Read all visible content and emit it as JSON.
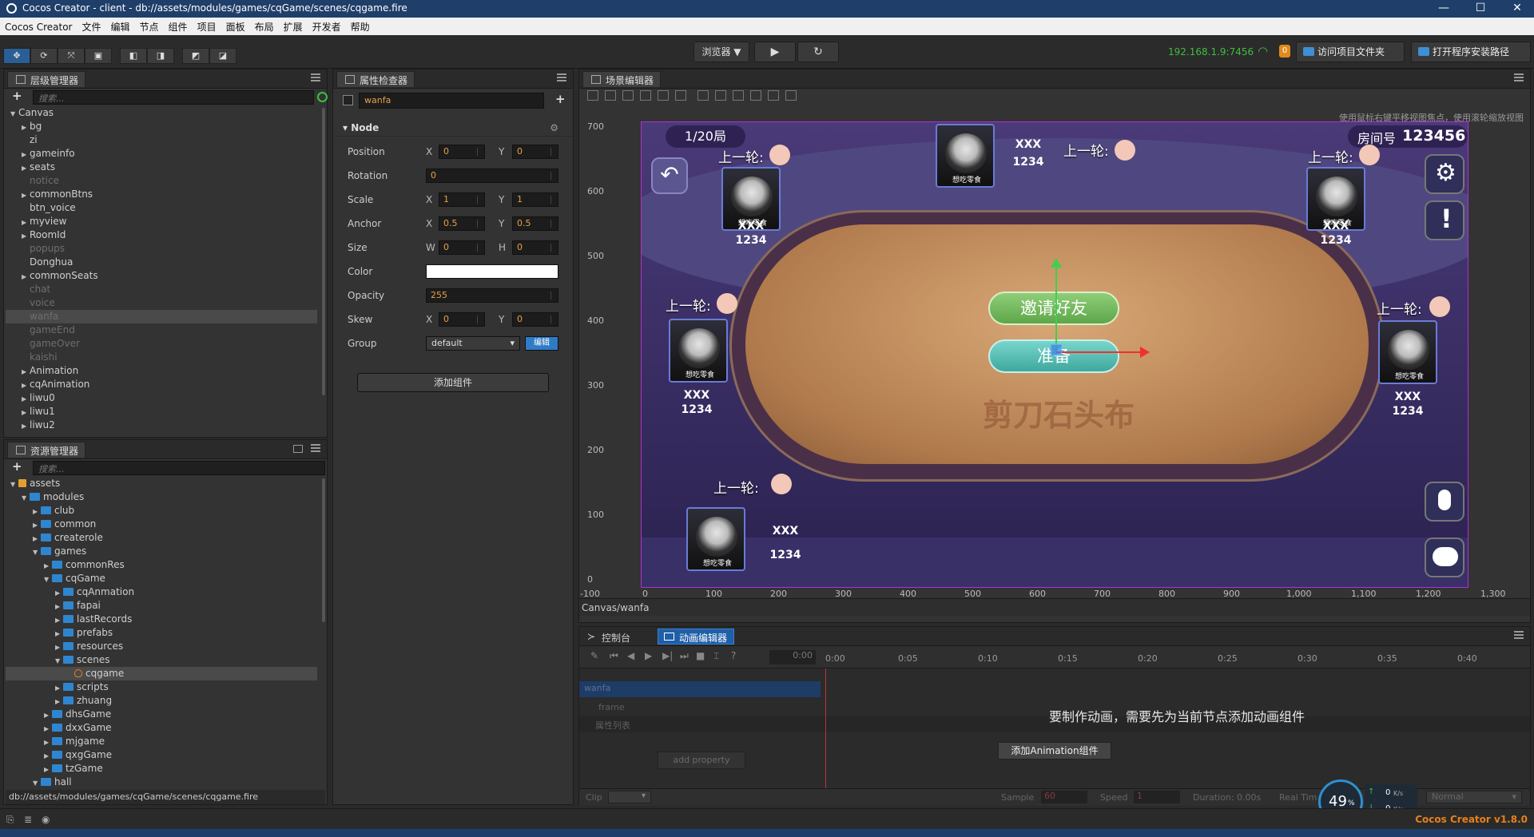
{
  "window": {
    "title": "Cocos Creator - client - db://assets/modules/games/cqGame/scenes/cqgame.fire"
  },
  "menu": [
    "Cocos Creator",
    "文件",
    "编辑",
    "节点",
    "组件",
    "项目",
    "面板",
    "布局",
    "扩展",
    "开发者",
    "帮助"
  ],
  "toolbar": {
    "preview_select": "浏览器 ▼",
    "play": "▶",
    "refresh": "↻",
    "ip": "192.168.1.9:7456",
    "badge": "0",
    "open_project_btn": "访问项目文件夹",
    "open_install_btn": "打开程序安装路径"
  },
  "hierarchy": {
    "tab": "层级管理器",
    "search_placeholder": "搜索...",
    "nodes": [
      {
        "label": "Canvas",
        "depth": 0,
        "arrow": "▼",
        "dim": false
      },
      {
        "label": "bg",
        "depth": 1,
        "arrow": "▶",
        "dim": false
      },
      {
        "label": "zi",
        "depth": 1,
        "arrow": "",
        "dim": false
      },
      {
        "label": "gameinfo",
        "depth": 1,
        "arrow": "▶",
        "dim": false
      },
      {
        "label": "seats",
        "depth": 1,
        "arrow": "▶",
        "dim": false
      },
      {
        "label": "notice",
        "depth": 1,
        "arrow": "",
        "dim": true
      },
      {
        "label": "commonBtns",
        "depth": 1,
        "arrow": "▶",
        "dim": false
      },
      {
        "label": "btn_voice",
        "depth": 1,
        "arrow": "",
        "dim": false
      },
      {
        "label": "myview",
        "depth": 1,
        "arrow": "▶",
        "dim": false
      },
      {
        "label": "RoomId",
        "depth": 1,
        "arrow": "▶",
        "dim": false
      },
      {
        "label": "popups",
        "depth": 1,
        "arrow": "",
        "dim": true
      },
      {
        "label": "Donghua",
        "depth": 1,
        "arrow": "",
        "dim": false
      },
      {
        "label": "commonSeats",
        "depth": 1,
        "arrow": "▶",
        "dim": false
      },
      {
        "label": "chat",
        "depth": 1,
        "arrow": "",
        "dim": true
      },
      {
        "label": "voice",
        "depth": 1,
        "arrow": "",
        "dim": true
      },
      {
        "label": "wanfa",
        "depth": 1,
        "arrow": "",
        "dim": true,
        "selected": true
      },
      {
        "label": "gameEnd",
        "depth": 1,
        "arrow": "",
        "dim": true
      },
      {
        "label": "gameOver",
        "depth": 1,
        "arrow": "",
        "dim": true
      },
      {
        "label": "kaishi",
        "depth": 1,
        "arrow": "",
        "dim": true
      },
      {
        "label": "Animation",
        "depth": 1,
        "arrow": "▶",
        "dim": false
      },
      {
        "label": "cqAnimation",
        "depth": 1,
        "arrow": "▶",
        "dim": false
      },
      {
        "label": "liwu0",
        "depth": 1,
        "arrow": "▶",
        "dim": false
      },
      {
        "label": "liwu1",
        "depth": 1,
        "arrow": "▶",
        "dim": false
      },
      {
        "label": "liwu2",
        "depth": 1,
        "arrow": "▶",
        "dim": false
      }
    ]
  },
  "assets": {
    "tab": "资源管理器",
    "search_placeholder": "搜索...",
    "footer_path": "db://assets/modules/games/cqGame/scenes/cqgame.fire",
    "nodes": [
      {
        "label": "assets",
        "depth": 0,
        "arrow": "▼",
        "icon": "lock"
      },
      {
        "label": "modules",
        "depth": 1,
        "arrow": "▼",
        "icon": "folder"
      },
      {
        "label": "club",
        "depth": 2,
        "arrow": "▶",
        "icon": "folder"
      },
      {
        "label": "common",
        "depth": 2,
        "arrow": "▶",
        "icon": "folder"
      },
      {
        "label": "createrole",
        "depth": 2,
        "arrow": "▶",
        "icon": "folder"
      },
      {
        "label": "games",
        "depth": 2,
        "arrow": "▼",
        "icon": "folder"
      },
      {
        "label": "commonRes",
        "depth": 3,
        "arrow": "▶",
        "icon": "folder"
      },
      {
        "label": "cqGame",
        "depth": 3,
        "arrow": "▼",
        "icon": "folder"
      },
      {
        "label": "cqAnmation",
        "depth": 4,
        "arrow": "▶",
        "icon": "folder"
      },
      {
        "label": "fapai",
        "depth": 4,
        "arrow": "▶",
        "icon": "folder"
      },
      {
        "label": "lastRecords",
        "depth": 4,
        "arrow": "▶",
        "icon": "folder"
      },
      {
        "label": "prefabs",
        "depth": 4,
        "arrow": "▶",
        "icon": "folder"
      },
      {
        "label": "resources",
        "depth": 4,
        "arrow": "▶",
        "icon": "folder"
      },
      {
        "label": "scenes",
        "depth": 4,
        "arrow": "▼",
        "icon": "folder"
      },
      {
        "label": "cqgame",
        "depth": 5,
        "arrow": "",
        "icon": "fire",
        "selected": true
      },
      {
        "label": "scripts",
        "depth": 4,
        "arrow": "▶",
        "icon": "folder"
      },
      {
        "label": "zhuang",
        "depth": 4,
        "arrow": "▶",
        "icon": "folder"
      },
      {
        "label": "dhsGame",
        "depth": 3,
        "arrow": "▶",
        "icon": "folder"
      },
      {
        "label": "dxxGame",
        "depth": 3,
        "arrow": "▶",
        "icon": "folder"
      },
      {
        "label": "mjgame",
        "depth": 3,
        "arrow": "▶",
        "icon": "folder"
      },
      {
        "label": "qxgGame",
        "depth": 3,
        "arrow": "▶",
        "icon": "folder"
      },
      {
        "label": "tzGame",
        "depth": 3,
        "arrow": "▶",
        "icon": "folder"
      },
      {
        "label": "hall",
        "depth": 2,
        "arrow": "▼",
        "icon": "folder"
      }
    ]
  },
  "inspector": {
    "tab": "属性检查器",
    "node_name": "wanfa",
    "section": "Node",
    "position": {
      "label": "Position",
      "x": "0",
      "y": "0"
    },
    "rotation": {
      "label": "Rotation",
      "value": "0"
    },
    "scale": {
      "label": "Scale",
      "x": "1",
      "y": "1"
    },
    "anchor": {
      "label": "Anchor",
      "x": "0.5",
      "y": "0.5"
    },
    "size": {
      "label": "Size",
      "w": "0",
      "h": "0"
    },
    "color": {
      "label": "Color",
      "value": "#ffffff"
    },
    "opacity": {
      "label": "Opacity",
      "value": "255"
    },
    "skew": {
      "label": "Skew",
      "x": "0",
      "y": "0"
    },
    "group": {
      "label": "Group",
      "value": "default",
      "edit": "编辑"
    },
    "add_component": "添加组件",
    "axis_x": "X",
    "axis_y": "Y",
    "axis_w": "W",
    "axis_h": "H"
  },
  "scene": {
    "tab": "场景编辑器",
    "hint": "使用鼠标右键平移视图焦点，使用滚轮缩放视图",
    "breadcrumb": "Canvas/wanfa",
    "ruler_y": [
      "700",
      "600",
      "500",
      "400",
      "300",
      "200",
      "100",
      "0"
    ],
    "ruler_x": [
      "-100",
      "0",
      "100",
      "200",
      "300",
      "400",
      "500",
      "600",
      "700",
      "800",
      "900",
      "1,000",
      "1,100",
      "1,200",
      "1,300"
    ]
  },
  "game": {
    "round": "1/20局",
    "room_label": "房间号",
    "room_no": "123456",
    "invite": "邀请好友",
    "ready": "准备",
    "watermark": "剪刀石头布",
    "last_round": "上一轮:",
    "nick": "想吃零食",
    "name": "XXX",
    "score": "1234"
  },
  "timeline": {
    "tab_console": "控制台",
    "tab_anim": "动画编辑器",
    "time": "0:00",
    "ticks": [
      "0:00",
      "0:05",
      "0:10",
      "0:15",
      "0:20",
      "0:25",
      "0:30",
      "0:35",
      "0:40"
    ],
    "node": "wanfa",
    "frame": "frame",
    "props": "属性列表",
    "add_property": "add property",
    "message": "要制作动画，需要先为当前节点添加动画组件",
    "add_anim_btn": "添加Animation组件",
    "clip": "Clip",
    "sample_label": "Sample",
    "sample": "60",
    "speed_label": "Speed",
    "speed": "1",
    "duration": "Duration: 0.00s",
    "realtime": "Real Tim",
    "wrap": "Normal"
  },
  "status": {
    "version": "Cocos Creator v1.8.0",
    "perf": "49",
    "perf_unit": "%",
    "up": "0",
    "down": "0",
    "rate_unit": "K/s"
  }
}
